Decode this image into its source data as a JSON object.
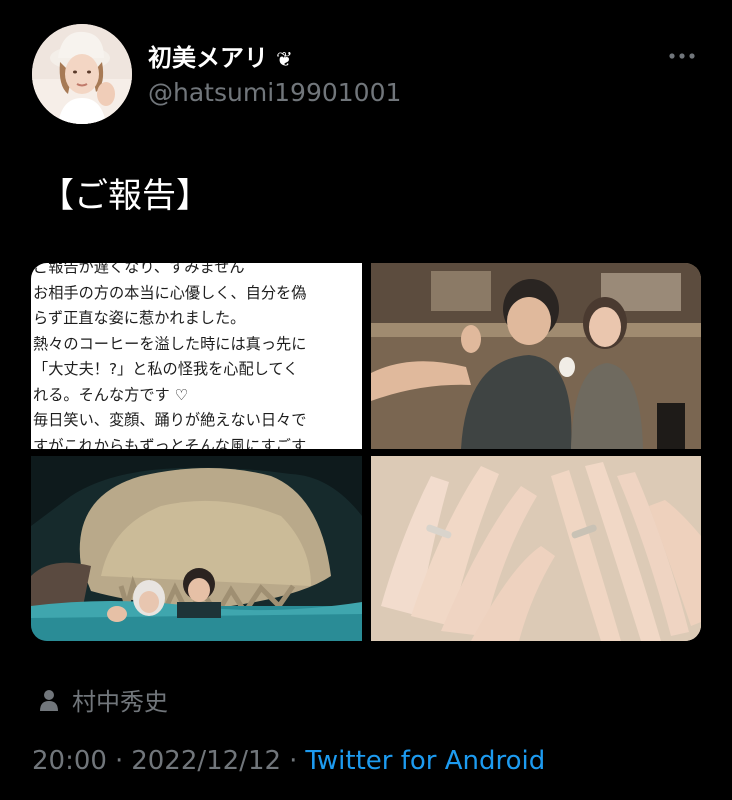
{
  "user": {
    "display_name": "初美メアリ",
    "name_emoji": "❦",
    "handle": "@hatsumi19901001",
    "avatar_icon": "avatar-photo"
  },
  "tweet": {
    "text": "【ご報告】",
    "note_lines": [
      "ご報告が遅くなり、すみません",
      "お相手の方の本当に心優しく、自分を偽",
      "らず正直な姿に惹かれました。",
      "熱々のコーヒーを溢した時には真っ先に",
      "「大丈夫！?」と私の怪我を心配してく",
      "れる。そんな方です ♡",
      "毎日笑い、変顔、踊りが絶えない日々で",
      "すがこれからもずっとそんな風にすごす"
    ],
    "media_alts": [
      "note-screenshot",
      "couple-photo",
      "cave-swim-photo",
      "wedding-rings-photo"
    ]
  },
  "author_tag": {
    "icon": "person-icon",
    "name": "村中秀史"
  },
  "meta": {
    "time": "20:00",
    "date": "2022/12/12",
    "separator": "·",
    "source": "Twitter for Android"
  },
  "colors": {
    "background": "#000000",
    "text": "#ffffff",
    "muted": "#71767b",
    "link": "#1d9bf0"
  }
}
